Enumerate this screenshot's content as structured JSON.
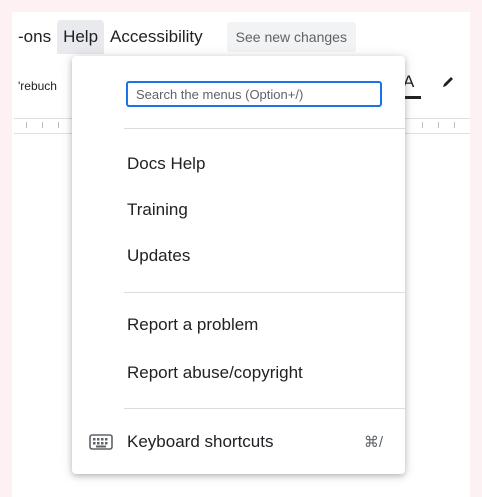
{
  "menubar": {
    "items": [
      {
        "label": "-ons"
      },
      {
        "label": "Help"
      },
      {
        "label": "Accessibility"
      }
    ],
    "see_changes_label": "See new changes"
  },
  "toolbar": {
    "left_text": "'rebuch",
    "text_color_glyph": "A",
    "pen_icon": "pen-icon"
  },
  "help_menu": {
    "search": {
      "value": "",
      "placeholder": "Search the menus (Option+/)"
    },
    "items": [
      {
        "label": "Docs Help"
      },
      {
        "label": "Training"
      },
      {
        "label": "Updates"
      },
      {
        "label": "Report a problem"
      },
      {
        "label": "Report abuse/copyright"
      },
      {
        "label": "Keyboard shortcuts",
        "shortcut": "⌘/",
        "icon": "keyboard-icon"
      }
    ]
  },
  "colors": {
    "accent": "#1a73e8",
    "page_background": "#fdf1f3",
    "active_menu_bg": "#e8eaed"
  }
}
